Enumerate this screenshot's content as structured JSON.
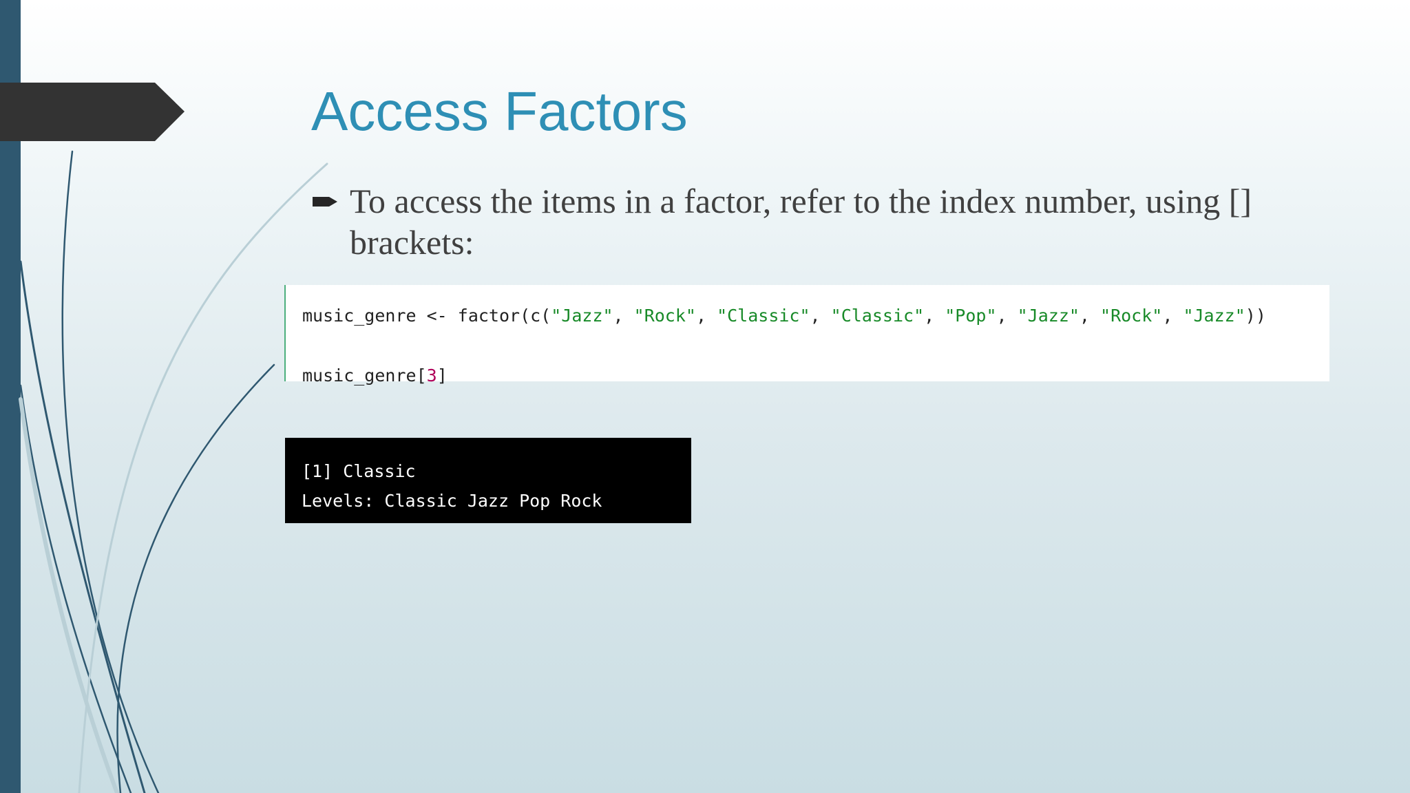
{
  "slide": {
    "title": "Access Factors",
    "bullet_text": "To access the items in a factor, refer to the index number, using [] brackets:"
  },
  "code": {
    "line1": {
      "prefix": "music_genre <- factor(c(",
      "s1": "\"Jazz\"",
      "s2": "\"Rock\"",
      "s3": "\"Classic\"",
      "s4": "\"Classic\"",
      "s5": "\"Pop\"",
      "s6": "\"Jazz\"",
      "s7": "\"Rock\"",
      "s8": "\"Jazz\"",
      "sep": ", ",
      "suffix": "))"
    },
    "line2": {
      "prefix": "music_genre[",
      "index": "3",
      "suffix": "]"
    }
  },
  "output": {
    "line1": "[1] Classic",
    "line2": "Levels: Classic Jazz Pop Rock"
  },
  "colors": {
    "title": "#2e8fb5",
    "string": "#188a28",
    "number": "#b0005a",
    "left_bar": "#2f5870",
    "chevron": "#333333"
  },
  "icons": {
    "bullet": "arrow-bullet-icon"
  }
}
